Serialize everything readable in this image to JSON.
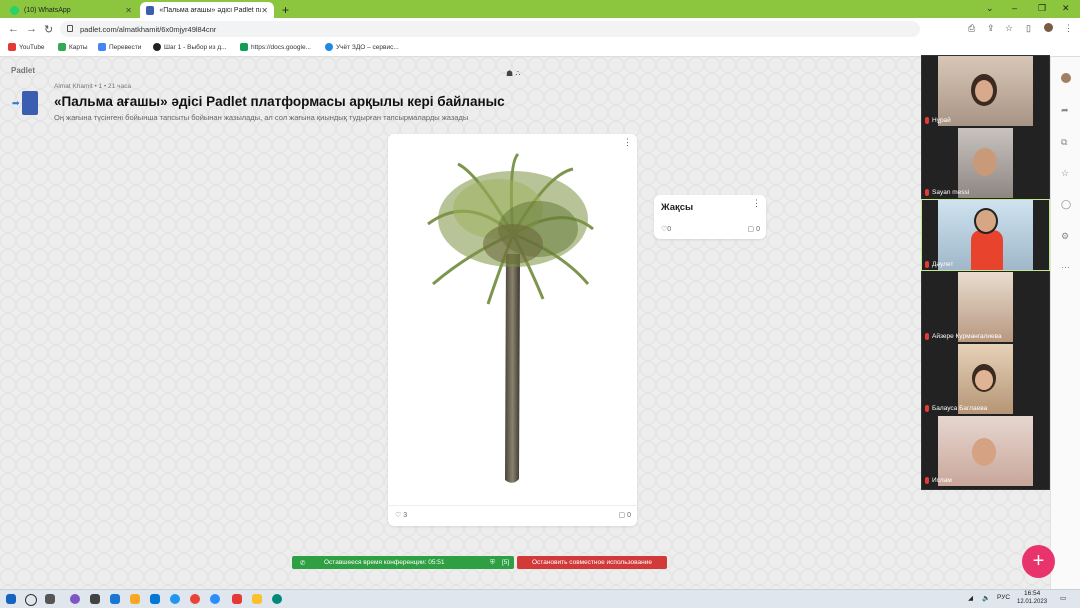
{
  "browser": {
    "tabs": [
      {
        "label": "(10) WhatsApp",
        "icon": "whatsapp-icon"
      },
      {
        "label": "«Пальма ағашы» әдісі Padlet пл",
        "icon": "padlet-icon"
      }
    ],
    "url": "padlet.com/almatkhamit/6x0mjyr49l84cnr",
    "bookmarks": [
      {
        "label": "YouTube",
        "icon": "youtube-icon",
        "color": "#e53935"
      },
      {
        "label": "Карты",
        "icon": "maps-icon",
        "color": "#34a853"
      },
      {
        "label": "Перевести",
        "icon": "translate-icon",
        "color": "#4285f4"
      },
      {
        "label": "Шаг 1 - Выбор из д...",
        "icon": "github-icon",
        "color": "#222222"
      },
      {
        "label": "https://docs.google...",
        "icon": "sheets-icon",
        "color": "#0f9d58"
      },
      {
        "label": "Учёт ЗДО – сервис...",
        "icon": "globe-icon",
        "color": "#1e88e5"
      }
    ]
  },
  "padlet": {
    "logo": "Padlet",
    "author": "Almat Khamit • 1 • 21 часа",
    "title": "«Пальма ағашы» әдісі Padlet платформасы арқылы кері байланыс",
    "description": "Оң жағына түсінгені бойынша тапсыты бойынан жазылады, ал сол жағына қиындық тудырған тапсырмаларды жазады",
    "main_card": {
      "likes": "3",
      "comments": "0",
      "image": "palm-tree"
    },
    "small_card": {
      "title": "Жақсы",
      "likes": "0",
      "comments": "0"
    }
  },
  "video": {
    "participants": [
      {
        "name": "Нұрай"
      },
      {
        "name": "Sayan messi"
      },
      {
        "name": "Дәулет"
      },
      {
        "name": "Айзере Курмангалиева"
      },
      {
        "name": "Балауса Баглаева"
      },
      {
        "name": "Ислам"
      }
    ]
  },
  "zoom_bar": {
    "remaining": "Оставшееся время конференции: 05:51",
    "count": "[5]",
    "stop": "Остановить совместное использование"
  },
  "taskbar": {
    "lang": "РУС",
    "time": "16:54",
    "date": "12.01.2023"
  },
  "colors": {
    "accent": "#e8336d",
    "zoom_green": "#2ea043",
    "zoom_red": "#d23a3a"
  }
}
